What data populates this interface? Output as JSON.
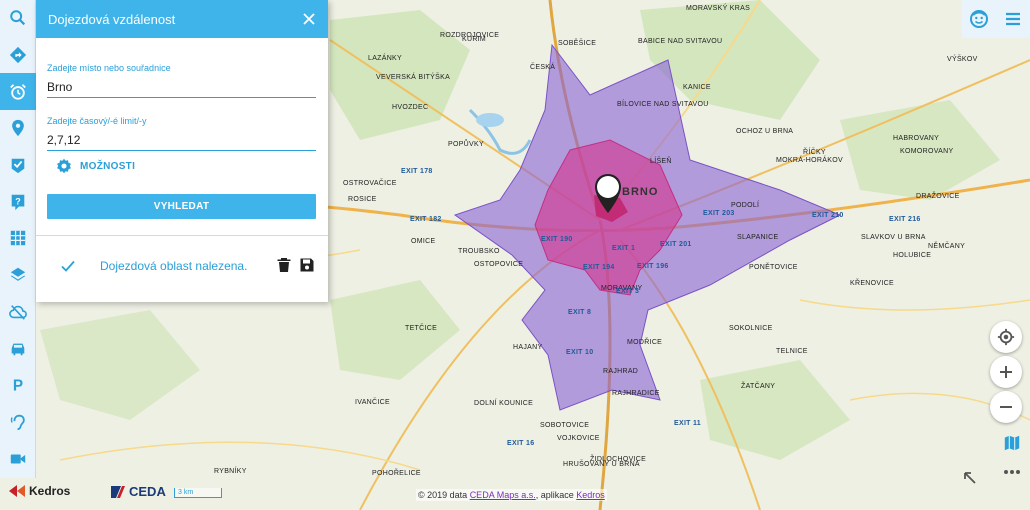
{
  "panel": {
    "title": "Dojezdová vzdálenost",
    "place_label": "Zadejte místo nebo souřadnice",
    "place_value": "Brno",
    "time_label": "Zadejte časový/-é limit/-y",
    "time_value": "2,7,12",
    "options_label": "MOŽNOSTI",
    "search_label": "VYHLEDAT",
    "result_text": "Dojezdová oblast nalezena."
  },
  "toolbar": {
    "items": [
      {
        "icon": "search-icon",
        "active": false
      },
      {
        "icon": "directions-icon",
        "active": false
      },
      {
        "icon": "alarm-clock-icon",
        "active": true
      },
      {
        "icon": "location-pin-icon",
        "active": false
      },
      {
        "icon": "checkbox-icon",
        "active": false
      },
      {
        "icon": "help-icon",
        "active": false
      },
      {
        "icon": "grid-icon",
        "active": false
      },
      {
        "icon": "layers-icon",
        "active": false
      },
      {
        "icon": "cloud-off-icon",
        "active": false
      },
      {
        "icon": "car-icon",
        "active": false
      },
      {
        "icon": "parking-icon",
        "active": false
      },
      {
        "icon": "hearing-icon",
        "active": false
      },
      {
        "icon": "video-icon",
        "active": false
      }
    ]
  },
  "map": {
    "city_label": "BRNO",
    "places": [
      "MORAVSKÝ KRAS",
      "ČESKÁ",
      "KURIM",
      "LAZÁNKY",
      "VEVERSKÁ BITÝŠKA",
      "HVOZDEC",
      "LÍŠEŇ",
      "BÍLOVICE NAD SVITAVOU",
      "ROZDROJOVICE",
      "OSTROVAČICE",
      "TROUBSKO",
      "OSTOPOVICE",
      "SLAPANICE",
      "PODOLÍ",
      "PONĚTOVICE",
      "MORAVANY",
      "ŽIDLOCHOVICE",
      "RAJHRAD",
      "MODŘICE",
      "HAJANY",
      "SOKOLNICE",
      "TELNICE",
      "ŽATČANY",
      "POPŮVKY",
      "ROSICE",
      "OMICE",
      "TETČICE",
      "IVANČICE",
      "DOLNÍ KOUNICE",
      "SOBOTOVICE",
      "VOJKOVICE",
      "HRUŠOVANY U BRNA",
      "RYBNÍKY",
      "VÝŠKOV",
      "SLAVKOV U BRNA",
      "KŘENOVICE",
      "HOLUBICE",
      "HABROVANY",
      "KOMOROVANY",
      "DRAŽOVICE",
      "NĚMČANY",
      "POHOŘELICE",
      "RAJHRADICE",
      "SOBĚŠICE",
      "OCHOZ U BRNA",
      "MOKRÁ-HORÁKOV",
      "ŘÍČKY",
      "KANICE",
      "BABICE NAD SVITAVOU"
    ],
    "exits": [
      "EXIT 178",
      "EXIT 182",
      "EXIT 190",
      "EXIT 194",
      "EXIT 196",
      "EXIT 201",
      "EXIT 203",
      "EXIT 210",
      "EXIT 216",
      "EXIT 1",
      "EXIT 8",
      "EXIT 10",
      "EXIT 11",
      "EXIT 16",
      "EXIT 3"
    ],
    "scale_label": "3 km",
    "attribution_prefix": "© 2019 data",
    "attribution_ceda": "CEDA Maps a.s.",
    "attribution_app": ", aplikace",
    "attribution_kedros": "Kedros"
  },
  "logos": {
    "kedros": "Kedros",
    "ceda": "CEDA"
  },
  "colors": {
    "accent": "#3fb4ea",
    "isochrone_outer": "#8a62d6",
    "isochrone_inner": "#d43b93"
  }
}
